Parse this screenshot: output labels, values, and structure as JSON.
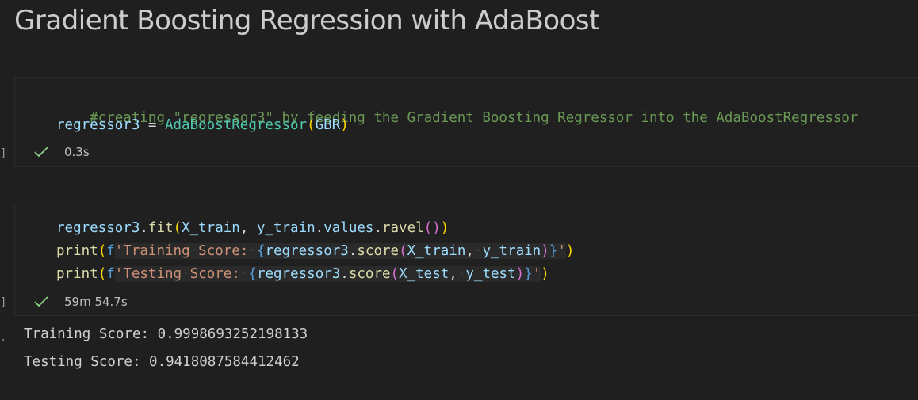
{
  "notebook": {
    "heading": "Gradient Boosting Regression with AdaBoost",
    "cells": [
      {
        "execution_label": "]",
        "code": {
          "comment": "#creating \"regressor3\" by feeding the Gradient Boosting Regressor into the AdaBoostRegressor",
          "line2": {
            "var": "regressor3",
            "eq": " = ",
            "cls": "AdaBoostRegressor",
            "open": "(",
            "arg": "GBR",
            "close": ")"
          }
        },
        "status": {
          "icon": "check-icon",
          "duration": "0.3s"
        }
      },
      {
        "execution_label": "]",
        "code": {
          "line1": {
            "obj": "regressor3",
            "dot1": ".",
            "method": "fit",
            "open": "(",
            "arg1": "X_train",
            "comma": ", ",
            "arg2": "y_train",
            "dot2": ".",
            "attr": "values",
            "dot3": ".",
            "method2": "ravel",
            "inner": "()",
            "close": ")"
          },
          "line2": {
            "fn": "print",
            "open": "(",
            "prefix": "f",
            "str_start": "'Training",
            "str_mid": "Score:",
            "brace_open": "{",
            "obj": "regressor3",
            "dot": ".",
            "method": "score",
            "p_open": "(",
            "arg1": "X_train",
            "comma": ",",
            "arg2": "y_train",
            "p_close": ")",
            "brace_close": "}",
            "str_end": "'",
            "close": ")"
          },
          "line3": {
            "fn": "print",
            "open": "(",
            "prefix": "f",
            "str_start": "'Testing",
            "str_mid": "Score:",
            "brace_open": "{",
            "obj": "regressor3",
            "dot": ".",
            "method": "score",
            "p_open": "(",
            "arg1": "X_test",
            "comma": ",",
            "arg2": "y_test",
            "p_close": ")",
            "brace_close": "}",
            "str_end": "'",
            "close": ")"
          }
        },
        "status": {
          "icon": "check-icon",
          "duration": "59m 54.7s"
        },
        "output": [
          "Training Score: 0.9998693252198133",
          "Testing Score: 0.9418087584412462"
        ]
      }
    ]
  },
  "colors": {
    "background": "#1f1f1f",
    "success_check": "#89d185",
    "comment": "#6a9955",
    "variable": "#9cdcfe",
    "class": "#4ec9b0",
    "function": "#dcdcaa",
    "string": "#ce9178"
  }
}
